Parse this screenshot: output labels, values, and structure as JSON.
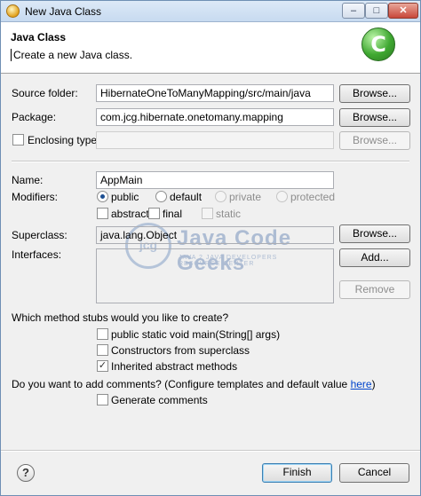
{
  "window": {
    "title": "New Java Class",
    "minimize": "–",
    "maximize": "□",
    "close": "✕"
  },
  "banner": {
    "title": "Java Class",
    "description": "Create a new Java class.",
    "logo_letter": "C"
  },
  "source_folder": {
    "label": "Source folder:",
    "value": "HibernateOneToManyMapping/src/main/java",
    "browse": "Browse..."
  },
  "package": {
    "label": "Package:",
    "value": "com.jcg.hibernate.onetomany.mapping",
    "browse": "Browse..."
  },
  "enclosing_type": {
    "label": "Enclosing type:",
    "value": "",
    "browse": "Browse..."
  },
  "name": {
    "label": "Name:",
    "value": "AppMain"
  },
  "modifiers": {
    "label": "Modifiers:",
    "public": "public",
    "default": "default",
    "private": "private",
    "protected": "protected",
    "abstract": "abstract",
    "final": "final",
    "static": "static"
  },
  "superclass": {
    "label": "Superclass:",
    "value": "java.lang.Object",
    "browse": "Browse..."
  },
  "interfaces": {
    "label": "Interfaces:",
    "add": "Add...",
    "remove": "Remove"
  },
  "stubs": {
    "question": "Which method stubs would you like to create?",
    "main": "public static void main(String[] args)",
    "constructors": "Constructors from superclass",
    "inherited": "Inherited abstract methods"
  },
  "comments": {
    "question": "Do you want to add comments? (Configure templates and default value ",
    "link": "here",
    "close": ")",
    "generate": "Generate comments"
  },
  "watermark": {
    "badge": "jcg",
    "text": "Java Code Geeks",
    "sub": "JAVA 2 JAVA DEVELOPERS RESOURCE CENTER"
  },
  "footer": {
    "help": "?",
    "finish": "Finish",
    "cancel": "Cancel"
  }
}
